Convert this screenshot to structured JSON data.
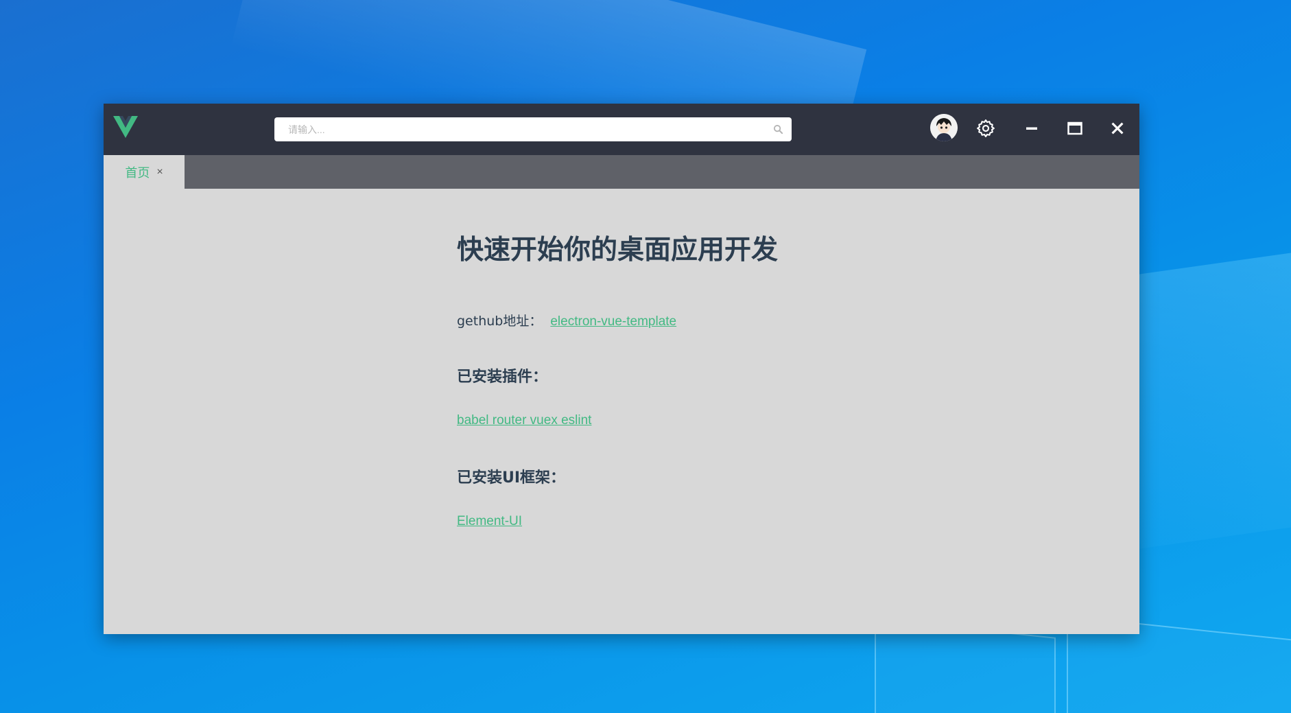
{
  "search": {
    "placeholder": "请输入..."
  },
  "tabs": [
    {
      "label": "首页",
      "close_glyph": "×",
      "active": true
    }
  ],
  "main": {
    "title": "快速开始你的桌面应用开发",
    "github_label": "gethub地址：",
    "github_link": "electron-vue-template",
    "plugins_heading": "已安装插件：",
    "plugins_link": "babel router vuex eslint",
    "ui_heading": "已安装UI框架：",
    "ui_link": "Element-UI"
  },
  "icons": {
    "logo": "vue-logo-icon",
    "search": "search-icon",
    "settings": "gear-icon",
    "minimize": "minimize-icon",
    "maximize": "maximize-icon",
    "close": "close-icon"
  },
  "colors": {
    "accent": "#42b983",
    "titlebar": "#2f3340",
    "tabbar": "#5f6168",
    "content_bg": "#d8d8d8",
    "heading_text": "#2c3e50"
  }
}
